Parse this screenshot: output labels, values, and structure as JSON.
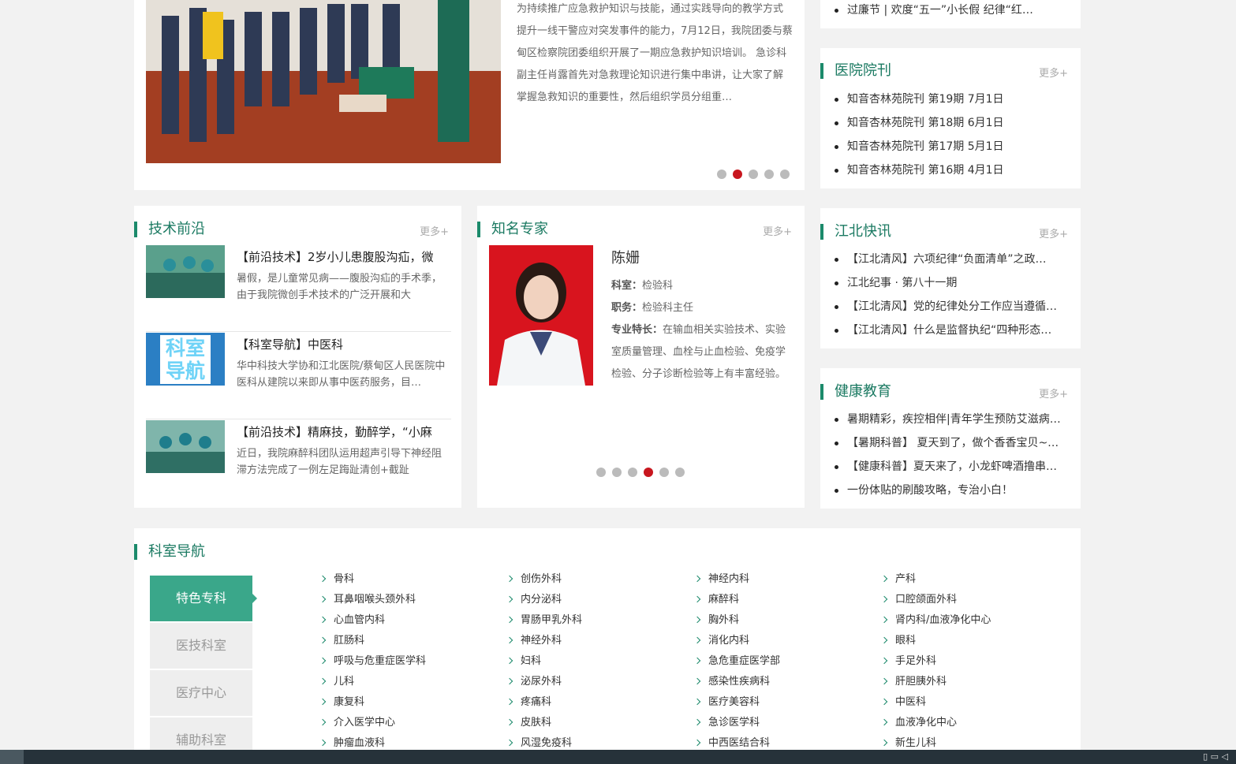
{
  "feature_news": {
    "summary": "为持续推广应急救护知识与技能，通过实践导向的教学方式提升一线干警应对突发事件的能力，7月12日，我院团委与蔡甸区检察院团委组织开展了一期应急救护知识培训。 急诊科副主任肖露首先对急救理论知识进行集中串讲，让大家了解掌握急救知识的重要性，然后组织学员分组重…",
    "slide_active": 2,
    "slide_count": 5
  },
  "top_list": {
    "items": [
      "过廉节 | 欢度“五一”小长假 纪律“红…"
    ]
  },
  "journal": {
    "title": "医院院刊",
    "more": "更多+",
    "items": [
      "知音杏林苑院刊 第19期 7月1日",
      "知音杏林苑院刊 第18期 6月1日",
      "知音杏林苑院刊 第17期 5月1日",
      "知音杏林苑院刊 第16期 4月1日"
    ]
  },
  "tech": {
    "title": "技术前沿",
    "more": "更多+",
    "items": [
      {
        "title": "【前沿技术】2岁小儿患腹股沟疝，微",
        "desc": "暑假，是儿童常见病——腹股沟疝的手术季，由于我院微创手术技术的广泛开展和大"
      },
      {
        "title": "【科室导航】中医科",
        "desc": "华中科技大学协和江北医院/蔡甸区人民医院中医科从建院以来即从事中医药服务，目…",
        "thumb_text": "科室导航"
      },
      {
        "title": "【前沿技术】精麻技，勤醉学，“小麻",
        "desc": "近日，我院麻醉科团队运用超声引导下神经阻滞方法完成了一例左足踇趾清创+截趾"
      }
    ]
  },
  "expert": {
    "title": "知名专家",
    "more": "更多+",
    "name": "陈姗",
    "dept_label": "科室：",
    "dept": "检验科",
    "post_label": "职务：",
    "post": "检验科主任",
    "spec_label": "专业特长：",
    "spec": "在输血相关实验技术、实验室质量管理、血栓与止血检验、免疫学检验、分子诊断检验等上有丰富经验。",
    "slide_active": 4,
    "slide_count": 6
  },
  "jiangbei": {
    "title": "江北快讯",
    "more": "更多+",
    "items": [
      "【江北清风】六项纪律“负面清单”之政…",
      "江北纪事 · 第八十一期",
      "【江北清风】党的纪律处分工作应当遵循…",
      "【江北清风】什么是监督执纪“四种形态…"
    ]
  },
  "health": {
    "title": "健康教育",
    "more": "更多+",
    "items": [
      "暑期精彩，疾控相伴|青年学生预防艾滋病…",
      "【暑期科普】 夏天到了，做个香香宝贝~…",
      "【健康科普】夏天来了，小龙虾啤酒撸串…",
      "一份体贴的刷酸攻略，专治小白！"
    ]
  },
  "departments": {
    "title": "科室导航",
    "tabs": [
      "特色专科",
      "医技科室",
      "医疗中心",
      "辅助科室"
    ],
    "active_tab": 0,
    "items": [
      "骨科",
      "创伤外科",
      "神经内科",
      "产科",
      "耳鼻咽喉头颈外科",
      "内分泌科",
      "麻醉科",
      "口腔颌面外科",
      "心血管内科",
      "胃肠甲乳外科",
      "胸外科",
      "肾内科/血液净化中心",
      "肛肠科",
      "神经外科",
      "消化内科",
      "眼科",
      "呼吸与危重症医学科",
      "妇科",
      "急危重症医学部",
      "手足外科",
      "儿科",
      "泌尿外科",
      "感染性疾病科",
      "肝胆胰外科",
      "康复科",
      "疼痛科",
      "医疗美容科",
      "中医科",
      "介入医学中心",
      "皮肤科",
      "急诊医学科",
      "血液净化中心",
      "肿瘤血液科",
      "风湿免疫科",
      "中西医结合科",
      "新生儿科"
    ]
  },
  "colors": {
    "accent": "#1b8a6b",
    "active_dot": "#c8161e",
    "tab_active": "#3aa78a"
  }
}
